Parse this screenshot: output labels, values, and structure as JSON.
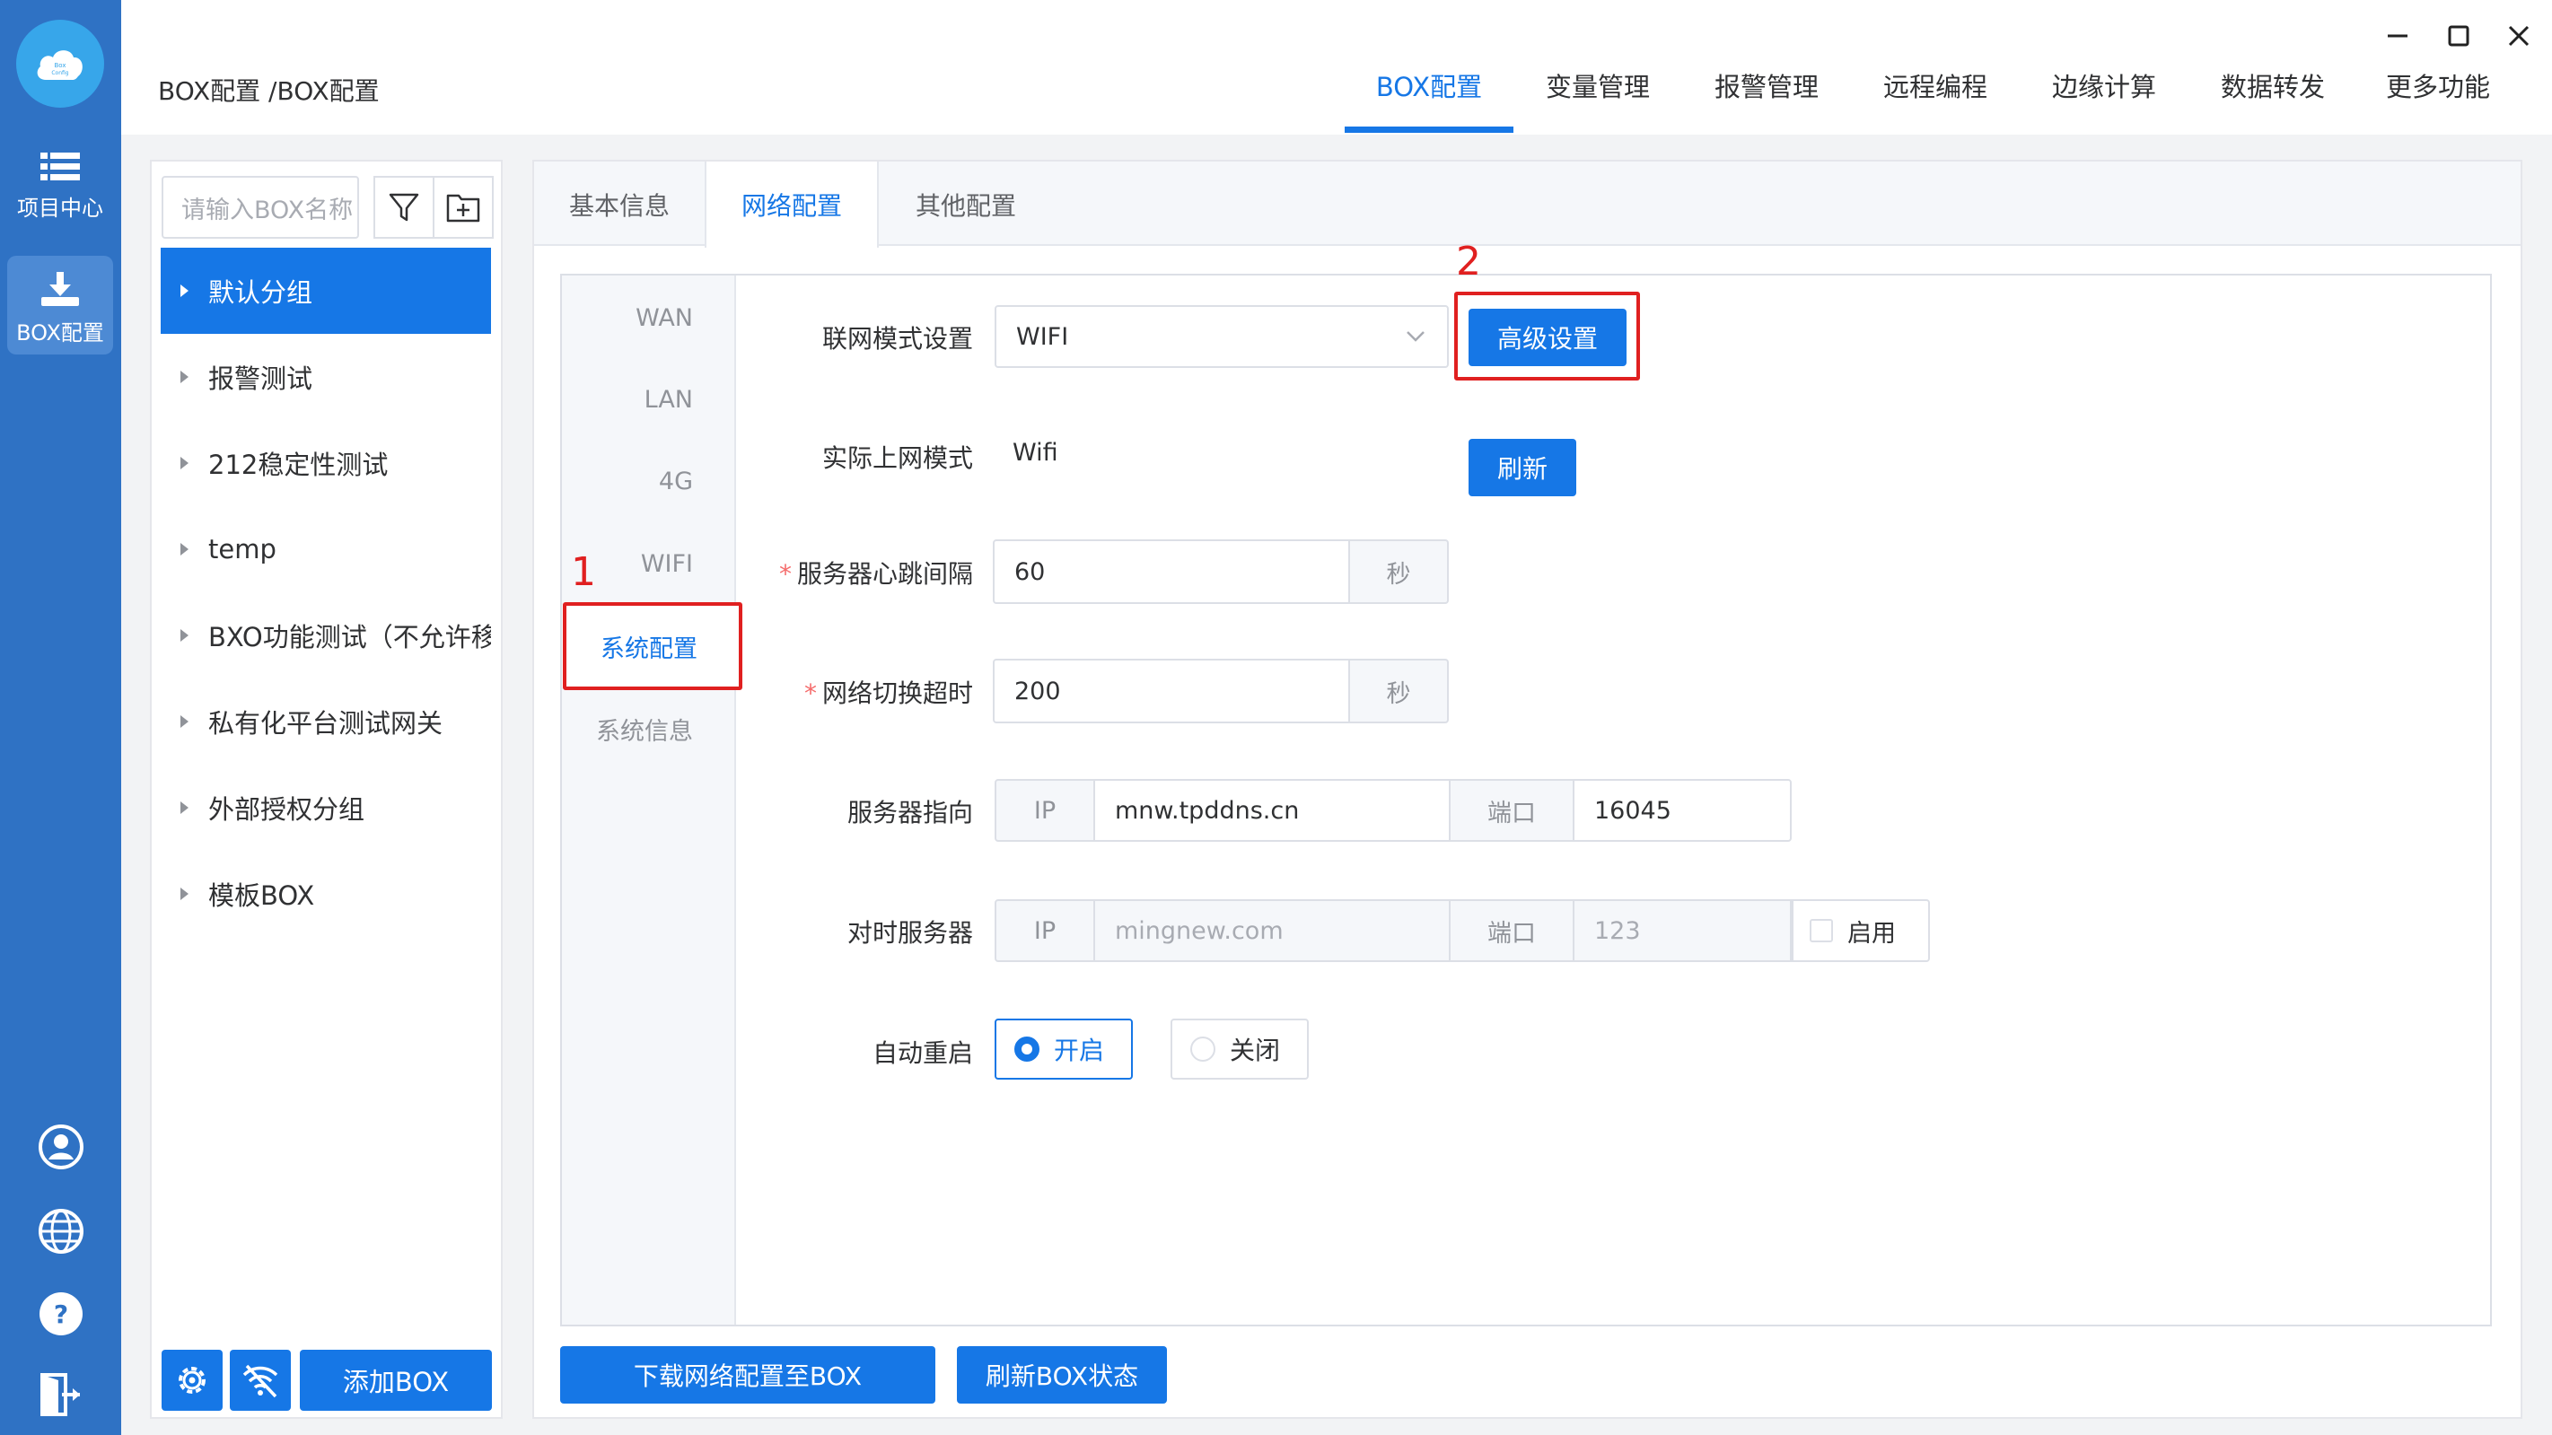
{
  "rail": {
    "logo_text": "Box Config",
    "items": [
      {
        "label": "项目中心",
        "icon": "list-icon"
      },
      {
        "label": "BOX配置",
        "icon": "download-icon"
      }
    ],
    "bottom_icons": [
      "user-icon",
      "globe-icon",
      "help-icon",
      "exit-icon"
    ]
  },
  "header": {
    "breadcrumb": "BOX配置 /BOX配置",
    "tabs": [
      "BOX配置",
      "变量管理",
      "报警管理",
      "远程编程",
      "边缘计算",
      "数据转发",
      "更多功能"
    ],
    "active_tab": "BOX配置"
  },
  "sidebar": {
    "search_placeholder": "请输入BOX名称",
    "groups": [
      "默认分组",
      "报警测试",
      "212稳定性测试",
      "temp",
      "BXO功能测试（不允许移动）",
      "私有化平台测试网关",
      "外部授权分组",
      "模板BOX"
    ],
    "active_group": "默认分组",
    "add_button": "添加BOX"
  },
  "panel": {
    "tabs": [
      "基本信息",
      "网络配置",
      "其他配置"
    ],
    "active_tab": "网络配置",
    "side_nav": [
      "WAN",
      "LAN",
      "4G",
      "WIFI",
      "系统配置",
      "系统信息"
    ],
    "active_side": "系统配置"
  },
  "form": {
    "network_mode": {
      "label": "联网模式设置",
      "value": "WIFI",
      "advanced_button": "高级设置"
    },
    "actual_mode": {
      "label": "实际上网模式",
      "value": "Wifi",
      "refresh_button": "刷新"
    },
    "heartbeat": {
      "label": "服务器心跳间隔",
      "value": "60",
      "unit": "秒"
    },
    "switch_timeout": {
      "label": "网络切换超时",
      "value": "200",
      "unit": "秒"
    },
    "server": {
      "label": "服务器指向",
      "ip_addon": "IP",
      "ip_value": "mnw.tpddns.cn",
      "port_addon": "端口",
      "port_value": "16045"
    },
    "time_server": {
      "label": "对时服务器",
      "ip_addon": "IP",
      "ip_placeholder": "mingnew.com",
      "port_addon": "端口",
      "port_placeholder": "123",
      "enable_label": "启用"
    },
    "auto_restart": {
      "label": "自动重启",
      "on": "开启",
      "off": "关闭",
      "selected": "开启"
    }
  },
  "footer_buttons": {
    "download": "下载网络配置至BOX",
    "refresh_state": "刷新BOX状态"
  },
  "annotations": {
    "one": "1",
    "two": "2"
  },
  "colors": {
    "primary": "#1677e6",
    "rail": "#2f72c4",
    "highlight": "#e02020"
  }
}
